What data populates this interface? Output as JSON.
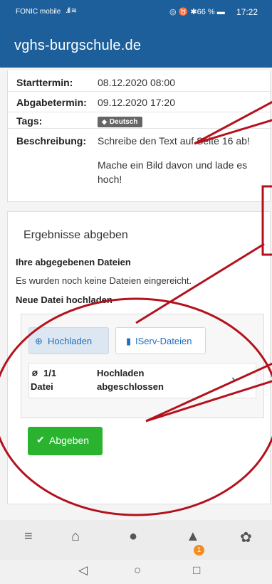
{
  "status_bar": {
    "carrier": "FONIC mobile",
    "signal": ".ıll ≋",
    "icons": "◎ ♉ ✱66 % ▬",
    "time": "17:22"
  },
  "app_bar": {
    "title": "vghs-burgschule.de"
  },
  "details": {
    "start_label": "Starttermin:",
    "start_value": "08.12.2020 08:00",
    "due_label": "Abgabetermin:",
    "due_value": "09.12.2020 17:20",
    "tags_label": "Tags:",
    "tag": "Deutsch",
    "desc_label": "Beschreibung:",
    "desc_line1": "Schreibe den Text auf Seite 16 ab!",
    "desc_line2": "Mache ein Bild davon und lade es",
    "desc_line3": "hoch!"
  },
  "submission": {
    "heading": "Ergebnisse abgeben",
    "files_heading": "Ihre abgegebenen Dateien",
    "no_files": "Es wurden noch keine Dateien eingereicht.",
    "upload_heading": "Neue Datei hochladen",
    "btn_upload": "Hochladen",
    "btn_iserv": "IServ-Dateien",
    "file_count": "1/1",
    "file_word": "Datei",
    "file_status1": "Hochladen",
    "file_status2": "abgeschlossen",
    "submit_label": "Abgeben"
  },
  "nav": {
    "notification_count": "1"
  },
  "colors": {
    "brand": "#1d5f9a",
    "submit": "#29b32f",
    "annotation": "#b3121c",
    "badge": "#f28c22"
  },
  "icons": [
    "menu-icon",
    "home-icon",
    "chat-icon",
    "bell-icon",
    "gear-icon",
    "back-icon",
    "home-circle-icon",
    "recents-icon"
  ]
}
